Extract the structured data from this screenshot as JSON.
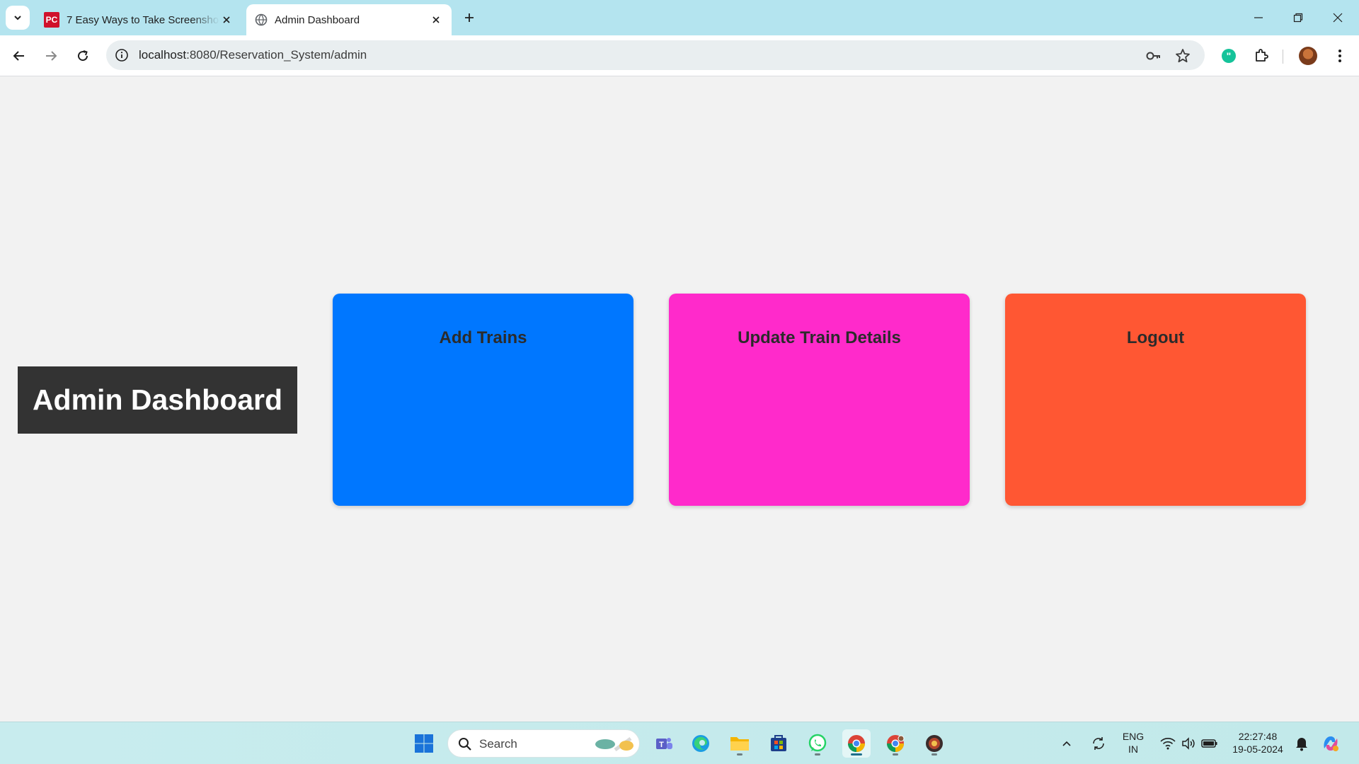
{
  "browser": {
    "tabs": [
      {
        "title": "7 Easy Ways to Take Screenshots on Windows",
        "favicon": "PC",
        "active": false
      },
      {
        "title": "Admin Dashboard",
        "active": true
      }
    ],
    "url_host": "localhost",
    "url_path": ":8080/Reservation_System/admin"
  },
  "page": {
    "title": "Admin Dashboard",
    "cards": [
      {
        "label": "Add Trains",
        "color": "#0077ff"
      },
      {
        "label": "Update Train Details",
        "color": "#ff2acb"
      },
      {
        "label": "Logout",
        "color": "#ff5733"
      }
    ]
  },
  "taskbar": {
    "search_label": "Search",
    "lang_top": "ENG",
    "lang_bottom": "IN",
    "time": "22:27:48",
    "date": "19-05-2024"
  }
}
